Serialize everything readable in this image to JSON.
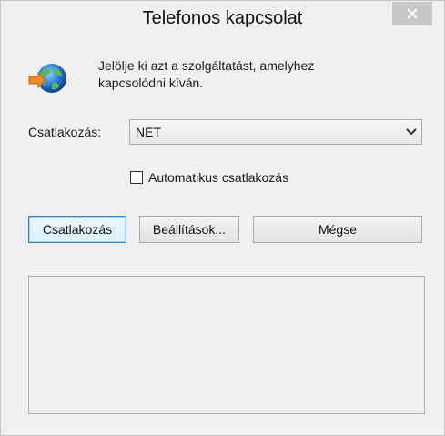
{
  "window": {
    "title": "Telefonos kapcsolat"
  },
  "dialog": {
    "prompt_line1": "Jelölje ki azt a szolgáltatást, amelyhez",
    "prompt_line2": "kapcsolódni kíván.",
    "connection_label": "Csatlakozás:",
    "connection_selected": "NET",
    "auto_connect_label": "Automatikus csatlakozás",
    "auto_connect_checked": false
  },
  "buttons": {
    "connect": "Csatlakozás",
    "settings": "Beállítások...",
    "cancel": "Mégse"
  },
  "icons": {
    "app_icon": "network-globe-icon",
    "close": "close-icon",
    "dropdown": "chevron-down-icon"
  },
  "colors": {
    "close_button_bg": "#c7c7c7",
    "default_button_border": "#3c7fb1"
  }
}
